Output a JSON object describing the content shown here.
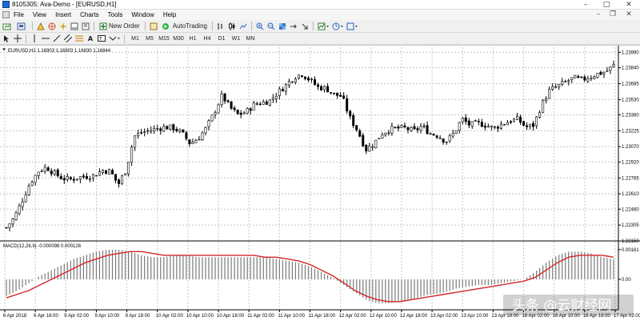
{
  "window": {
    "title": "8105305: Ava-Demo - [EURUSD,H1]"
  },
  "menu": [
    "File",
    "View",
    "Insert",
    "Charts",
    "Tools",
    "Window",
    "Help"
  ],
  "toolbar": {
    "new_order_label": "New Order",
    "autotrading_label": "AutoTrading",
    "timeframes": [
      "M1",
      "M5",
      "M15",
      "M30",
      "H1",
      "H4",
      "D1",
      "W1",
      "MN"
    ]
  },
  "chart_data": [
    {
      "type": "candlestick",
      "header": "EURUSD,H1  1.16903 1.16903 1.16830 1.16844",
      "y_ticks": [
        "1.23990",
        "1.23840",
        "1.23685",
        "1.23530",
        "1.23380",
        "1.23225",
        "1.23070",
        "1.22920",
        "1.22765",
        "1.22610",
        "1.22460",
        "1.22305",
        "1.22150"
      ],
      "y_range": [
        1.2215,
        1.2404
      ],
      "x_ticks": [
        "6 Apr 2018",
        "6 Apr 18:00",
        "9 Apr 02:00",
        "9 Apr 10:00",
        "9 Apr 18:00",
        "10 Apr 02:00",
        "10 Apr 10:00",
        "10 Apr 18:00",
        "11 Apr 02:00",
        "11 Apr 10:00",
        "11 Apr 18:00",
        "12 Apr 02:00",
        "12 Apr 10:00",
        "12 Apr 18:00",
        "13 Apr 02:00",
        "13 Apr 10:00",
        "13 Apr 18:00",
        "16 Apr 02:00",
        "16 Apr 10:00",
        "16 Apr 18:00",
        "17 Apr 02:00"
      ],
      "close_path": [
        1.2228,
        1.2238,
        1.2255,
        1.2272,
        1.2283,
        1.2287,
        1.2281,
        1.2276,
        1.2275,
        1.2277,
        1.2278,
        1.2279,
        1.2284,
        1.2283,
        1.227,
        1.2285,
        1.2317,
        1.2321,
        1.2323,
        1.2325,
        1.2326,
        1.2325,
        1.232,
        1.231,
        1.2315,
        1.2325,
        1.234,
        1.2357,
        1.2345,
        1.2338,
        1.2341,
        1.2348,
        1.235,
        1.2352,
        1.236,
        1.2367,
        1.2375,
        1.2378,
        1.2372,
        1.2365,
        1.2364,
        1.2358,
        1.2356,
        1.2335,
        1.2322,
        1.2304,
        1.231,
        1.232,
        1.2324,
        1.2325,
        1.2325,
        1.2322,
        1.2327,
        1.232,
        1.2318,
        1.2312,
        1.232,
        1.2334,
        1.2328,
        1.233,
        1.2328,
        1.2325,
        1.2329,
        1.2332,
        1.2334,
        1.2326,
        1.2328,
        1.2348,
        1.2362,
        1.2366,
        1.237,
        1.2374,
        1.2372,
        1.2375,
        1.2378,
        1.238,
        1.2386
      ]
    },
    {
      "type": "bar+line",
      "header": "MACD(12,26,9) -0.000098 0.000126",
      "y_ticks": [
        "0.00161",
        "0.00"
      ],
      "x_ticks": [
        "6 Apr 2018",
        "6 Apr 18:00",
        "9 Apr 02:00",
        "9 Apr 10:00",
        "9 Apr 18:00",
        "10 Apr 02:00",
        "10 Apr 10:00",
        "10 Apr 18:00",
        "11 Apr 02:00",
        "11 Apr 10:00",
        "11 Apr 18:00",
        "12 Apr 02:00",
        "12 Apr 10:00",
        "12 Apr 18:00",
        "13 Apr 02:00",
        "13 Apr 10:00",
        "13 Apr 18:00",
        "16 Apr 02:00",
        "16 Apr 10:00",
        "16 Apr 18:00",
        "17 Apr 02:00"
      ],
      "series": [
        {
          "name": "MACD",
          "values": [
            -0.0009,
            -0.0006,
            -0.0002,
            0.0002,
            0.0005,
            0.0008,
            0.0011,
            0.0013,
            0.0015,
            0.0016,
            0.0016,
            0.0015,
            0.0013,
            0.0012,
            0.0012,
            0.0013,
            0.0013,
            0.0012,
            0.0012,
            0.0012,
            0.0012,
            0.0012,
            0.0012,
            0.0012,
            0.0011,
            0.001,
            0.0009,
            0.0007,
            0.0004,
            0.0001,
            -0.0003,
            -0.0007,
            -0.0011,
            -0.0013,
            -0.0013,
            -0.0012,
            -0.0011,
            -0.0009,
            -0.0008,
            -0.0007,
            -0.0005,
            -0.0004,
            -0.0003,
            -0.0003,
            -0.0002,
            -0.0001,
            0.0,
            0.0004,
            0.0009,
            0.0013,
            0.0015,
            0.0015,
            0.0014,
            0.0012,
            0.0011
          ]
        },
        {
          "name": "Signal",
          "values": [
            -0.001,
            -0.0008,
            -0.0006,
            -0.0003,
            0.0,
            0.0003,
            0.0006,
            0.0009,
            0.0011,
            0.0013,
            0.0014,
            0.0015,
            0.0015,
            0.0014,
            0.0013,
            0.0013,
            0.0013,
            0.0013,
            0.0013,
            0.0013,
            0.0013,
            0.0013,
            0.0013,
            0.0012,
            0.0012,
            0.0011,
            0.001,
            0.0008,
            0.0005,
            0.0002,
            -0.0002,
            -0.0006,
            -0.0009,
            -0.0011,
            -0.0012,
            -0.0012,
            -0.0011,
            -0.001,
            -0.0009,
            -0.0008,
            -0.0007,
            -0.0006,
            -0.0005,
            -0.0004,
            -0.0003,
            -0.0002,
            -0.0001,
            0.0001,
            0.0005,
            0.0009,
            0.0012,
            0.0013,
            0.0013,
            0.0013,
            0.0012
          ]
        }
      ],
      "colors": {
        "histogram": "#7a7a7a",
        "signal": "#d42626"
      }
    }
  ],
  "watermark": "头条 @云财经网"
}
